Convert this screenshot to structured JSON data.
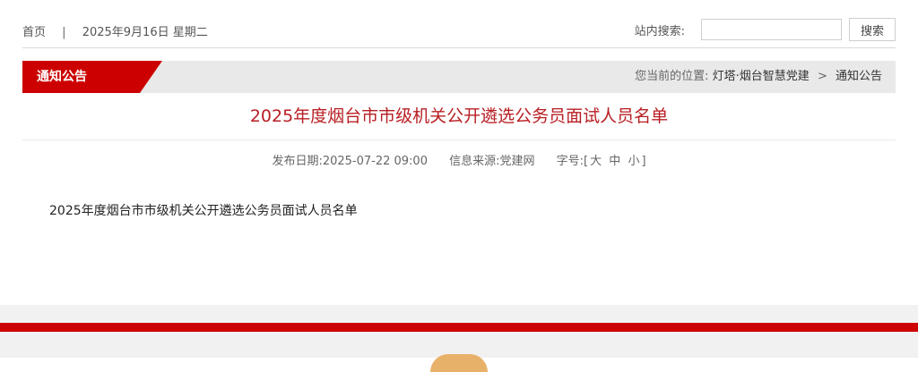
{
  "topbar": {
    "home": "首页",
    "separator": "|",
    "date": "2025年9月16日 星期二",
    "search_label": "站内搜索:",
    "search_placeholder": "",
    "search_button": "搜索"
  },
  "section": {
    "tab_label": "通知公告",
    "location_label": "您当前的位置:",
    "breadcrumb": [
      "灯塔·烟台智慧党建",
      "通知公告"
    ],
    "breadcrumb_arrow": ">"
  },
  "article": {
    "title": "2025年度烟台市市级机关公开遴选公务员面试人员名单",
    "publish_date": "发布日期:2025-07-22 09:00",
    "source": "信息来源:党建网",
    "font_size_label": "字号:",
    "font_size_open": "[",
    "font_size_options": [
      "大",
      "中",
      "小"
    ],
    "font_size_close": "]",
    "body": "2025年度烟台市市级机关公开遴选公务员面试人员名单"
  },
  "colors": {
    "accent": "#cc0000",
    "title": "#b81e23"
  },
  "icons": {
    "footer_logo": "party-emblem-icon"
  }
}
